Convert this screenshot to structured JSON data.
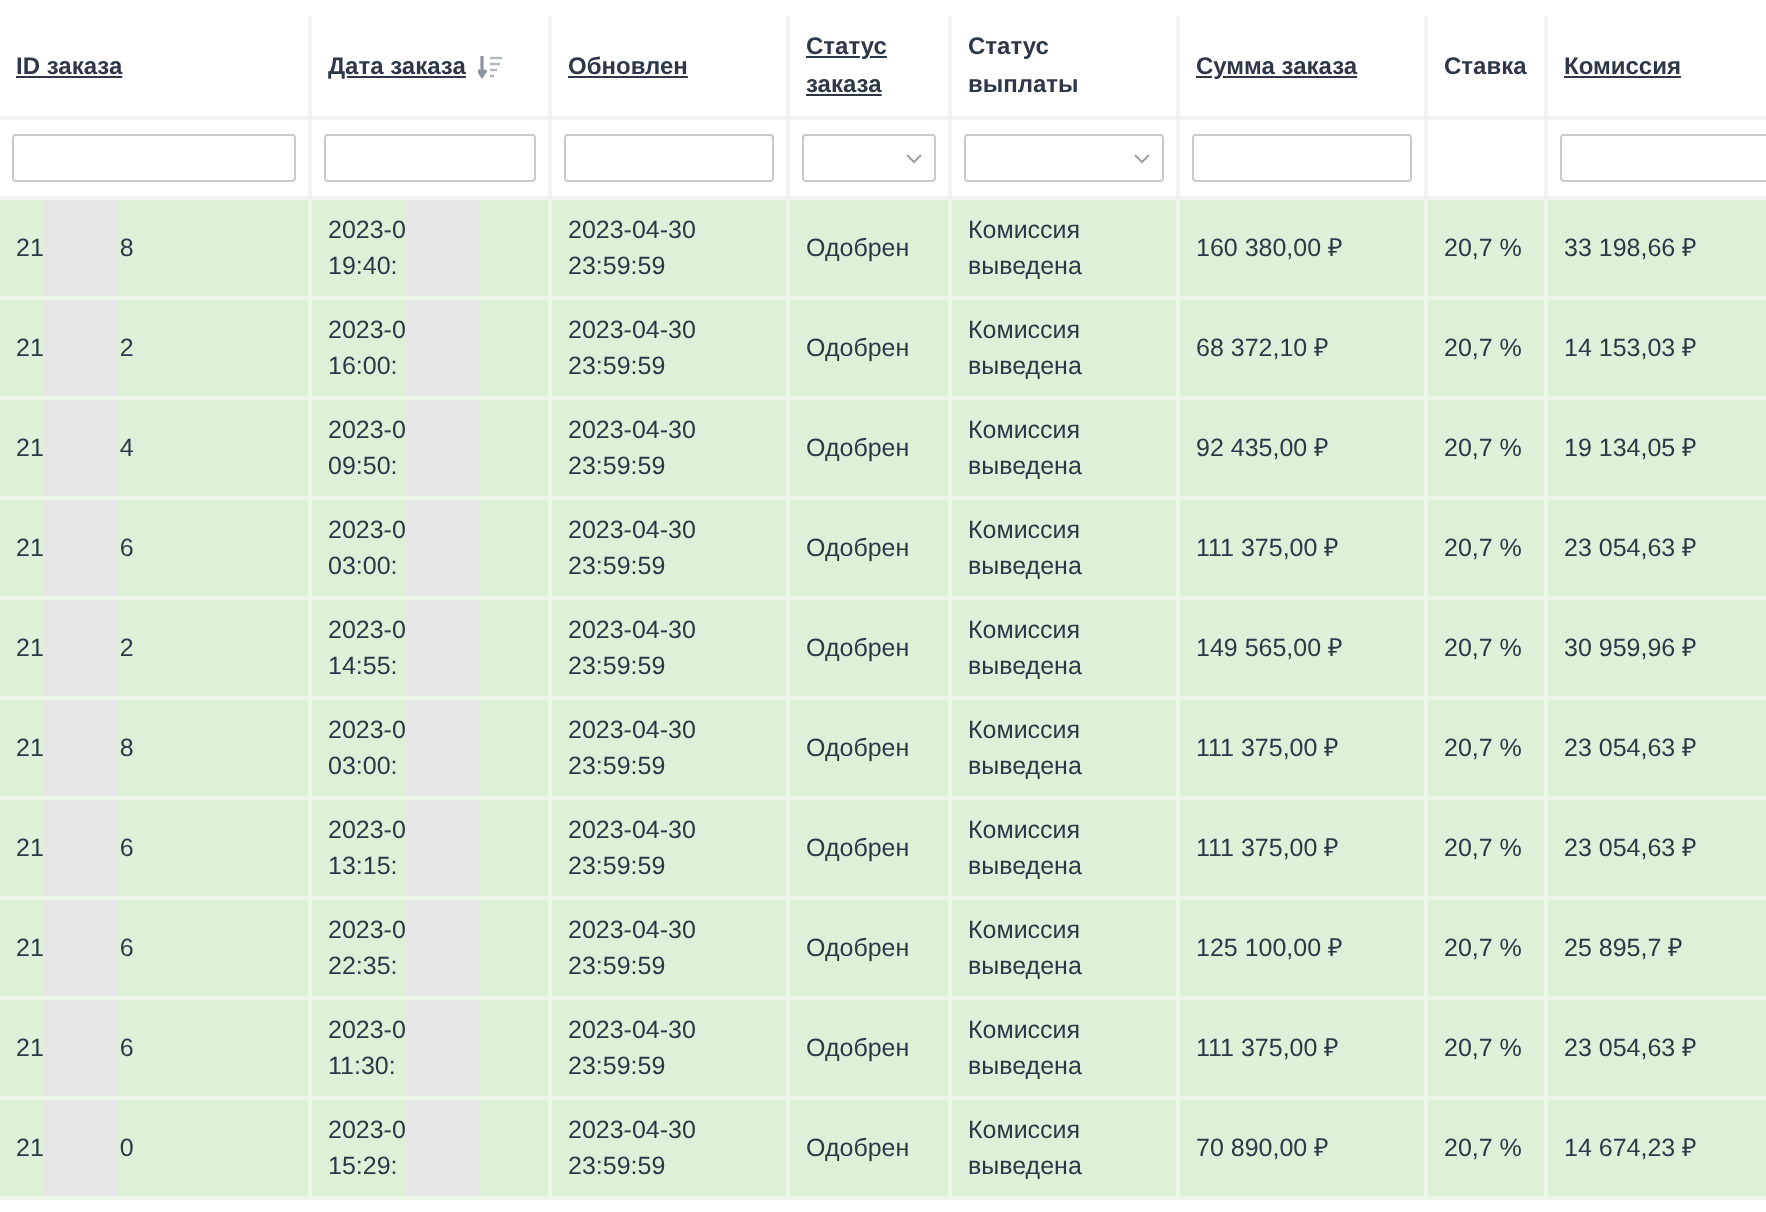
{
  "columns": [
    {
      "label": "ID заказа",
      "sortable": true,
      "sorted": false,
      "filter": {
        "kind": "text"
      }
    },
    {
      "label": "Дата заказа",
      "sortable": true,
      "sorted": true,
      "filter": {
        "kind": "text"
      }
    },
    {
      "label": "Обновлен",
      "sortable": true,
      "sorted": false,
      "filter": {
        "kind": "text"
      }
    },
    {
      "label": "Статус заказа",
      "sortable": true,
      "sorted": false,
      "filter": {
        "kind": "select"
      }
    },
    {
      "label": "Статус выплаты",
      "sortable": false,
      "filter": {
        "kind": "select"
      }
    },
    {
      "label": "Сумма заказа",
      "sortable": true,
      "sorted": false,
      "filter": {
        "kind": "text"
      }
    },
    {
      "label": "Ставка",
      "sortable": false
    },
    {
      "label": "Комиссия",
      "sortable": true,
      "sorted": false,
      "filter": {
        "kind": "text"
      }
    }
  ],
  "rows": [
    {
      "id_start": "21",
      "id_end": "8",
      "date": "2023-0",
      "time": "19:40:",
      "updated": "2023-04-30 23:59:59",
      "status": "Одобрен",
      "payout": "Комиссия выведена",
      "amount": "160 380,00 ₽",
      "rate": "20,7 %",
      "commission": "33 198,66 ₽"
    },
    {
      "id_start": "21",
      "id_end": "2",
      "date": "2023-0",
      "time": "16:00:",
      "updated": "2023-04-30 23:59:59",
      "status": "Одобрен",
      "payout": "Комиссия выведена",
      "amount": "68 372,10 ₽",
      "rate": "20,7 %",
      "commission": "14 153,03 ₽"
    },
    {
      "id_start": "21",
      "id_end": "4",
      "date": "2023-0",
      "time": "09:50:",
      "updated": "2023-04-30 23:59:59",
      "status": "Одобрен",
      "payout": "Комиссия выведена",
      "amount": "92 435,00 ₽",
      "rate": "20,7 %",
      "commission": "19 134,05 ₽"
    },
    {
      "id_start": "21",
      "id_end": "6",
      "date": "2023-0",
      "time": "03:00:",
      "updated": "2023-04-30 23:59:59",
      "status": "Одобрен",
      "payout": "Комиссия выведена",
      "amount": "111 375,00 ₽",
      "rate": "20,7 %",
      "commission": "23 054,63 ₽"
    },
    {
      "id_start": "21",
      "id_end": "2",
      "date": "2023-0",
      "time": "14:55:",
      "updated": "2023-04-30 23:59:59",
      "status": "Одобрен",
      "payout": "Комиссия выведена",
      "amount": "149 565,00 ₽",
      "rate": "20,7 %",
      "commission": "30 959,96 ₽"
    },
    {
      "id_start": "21",
      "id_end": "8",
      "date": "2023-0",
      "time": "03:00:",
      "updated": "2023-04-30 23:59:59",
      "status": "Одобрен",
      "payout": "Комиссия выведена",
      "amount": "111 375,00 ₽",
      "rate": "20,7 %",
      "commission": "23 054,63 ₽"
    },
    {
      "id_start": "21",
      "id_end": "6",
      "date": "2023-0",
      "time": "13:15:",
      "updated": "2023-04-30 23:59:59",
      "status": "Одобрен",
      "payout": "Комиссия выведена",
      "amount": "111 375,00 ₽",
      "rate": "20,7 %",
      "commission": "23 054,63 ₽"
    },
    {
      "id_start": "21",
      "id_end": "6",
      "date": "2023-0",
      "time": "22:35:",
      "updated": "2023-04-30 23:59:59",
      "status": "Одобрен",
      "payout": "Комиссия выведена",
      "amount": "125 100,00 ₽",
      "rate": "20,7 %",
      "commission": "25 895,7 ₽"
    },
    {
      "id_start": "21",
      "id_end": "6",
      "date": "2023-0",
      "time": "11:30:",
      "updated": "2023-04-30 23:59:59",
      "status": "Одобрен",
      "payout": "Комиссия выведена",
      "amount": "111 375,00 ₽",
      "rate": "20,7 %",
      "commission": "23 054,63 ₽"
    },
    {
      "id_start": "21",
      "id_end": "0",
      "date": "2023-0",
      "time": "15:29:",
      "updated": "2023-04-30 23:59:59",
      "status": "Одобрен",
      "payout": "Комиссия выведена",
      "amount": "70 890,00 ₽",
      "rate": "20,7 %",
      "commission": "14 674,23 ₽"
    }
  ]
}
